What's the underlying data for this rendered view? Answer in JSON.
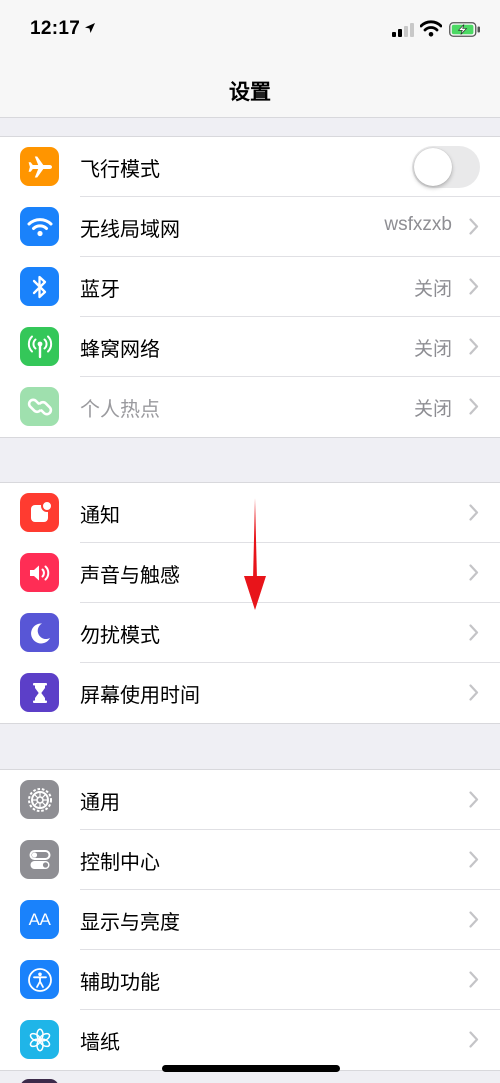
{
  "status_bar": {
    "time": "12:17"
  },
  "nav": {
    "title": "设置"
  },
  "colors": {
    "orange": "#ff9500",
    "blue": "#1a82fb",
    "green": "#34c759",
    "green_dim": "#9fe0ae",
    "red": "#ff3b30",
    "pink": "#ff2d55",
    "indigo": "#5856d6",
    "purple": "#5c3fc8",
    "gray": "#8e8e93",
    "battery": "#4cd964"
  },
  "groups": [
    {
      "rows": [
        {
          "icon": "airplane-icon",
          "label": "飞行模式",
          "toggle": "off"
        },
        {
          "icon": "wifi-icon",
          "label": "无线局域网",
          "value": "wsfxzxb"
        },
        {
          "icon": "bluetooth-icon",
          "label": "蓝牙",
          "value": "关闭"
        },
        {
          "icon": "cellular-icon",
          "label": "蜂窝网络",
          "value": "关闭"
        },
        {
          "icon": "hotspot-icon",
          "label": "个人热点",
          "value": "关闭",
          "disabled": true
        }
      ]
    },
    {
      "rows": [
        {
          "icon": "notifications-icon",
          "label": "通知"
        },
        {
          "icon": "sound-icon",
          "label": "声音与触感"
        },
        {
          "icon": "moon-icon",
          "label": "勿扰模式"
        },
        {
          "icon": "hourglass-icon",
          "label": "屏幕使用时间"
        }
      ]
    },
    {
      "rows": [
        {
          "icon": "gear-icon",
          "label": "通用"
        },
        {
          "icon": "control-center-icon",
          "label": "控制中心"
        },
        {
          "icon": "display-icon",
          "label": "显示与亮度",
          "icon_text": "AA"
        },
        {
          "icon": "accessibility-icon",
          "label": "辅助功能"
        },
        {
          "icon": "wallpaper-icon",
          "label": "墙纸"
        }
      ]
    }
  ]
}
